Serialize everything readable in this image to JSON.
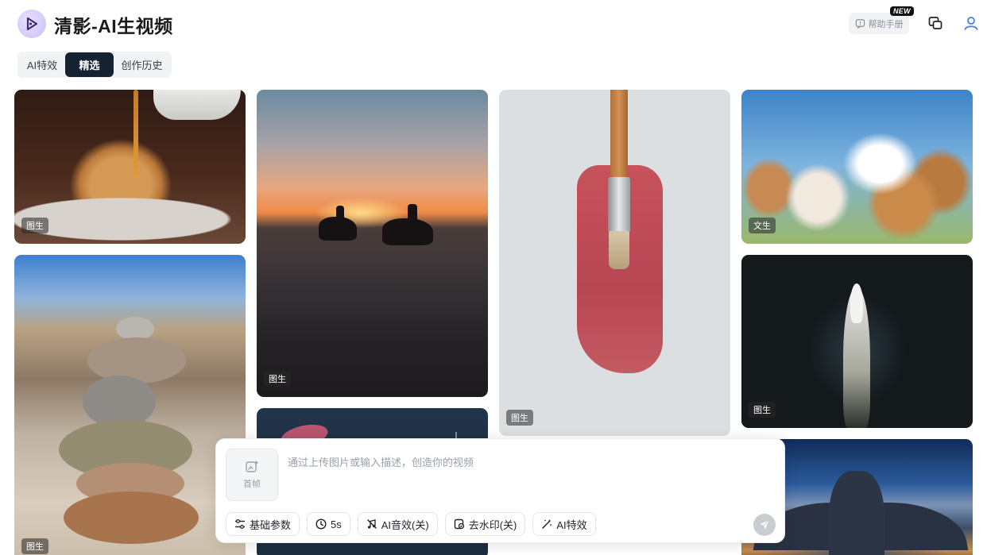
{
  "app": {
    "title": "清影-AI生视频",
    "logo_icon": "play-logo-icon",
    "accent": "#152232"
  },
  "header": {
    "help_label": "帮助手册",
    "new_badge": "NEW",
    "icons": [
      "help-manual-icon",
      "window-switch-icon",
      "user-icon"
    ]
  },
  "tabs": [
    {
      "label": "AI特效",
      "active": false
    },
    {
      "label": "精选",
      "active": true
    },
    {
      "label": "创作历史",
      "active": false
    }
  ],
  "gallery": [
    {
      "subject": "pancakes",
      "tag": "图生"
    },
    {
      "subject": "horse-riders-sunset",
      "tag": "图生"
    },
    {
      "subject": "paint-brush",
      "tag": "图生"
    },
    {
      "subject": "puppies",
      "tag": "文生"
    },
    {
      "subject": "stone-stack",
      "tag": "图生"
    },
    {
      "subject": "boat-aerial",
      "tag": "图生"
    },
    {
      "subject": "bird",
      "tag": ""
    },
    {
      "subject": "dragon-city",
      "tag": ""
    }
  ],
  "composer": {
    "upload_label": "首帧",
    "placeholder": "通过上传图片或输入描述，创造你的视频",
    "value": "",
    "tools": [
      {
        "icon": "sliders-icon",
        "label": "基础参数"
      },
      {
        "icon": "clock-icon",
        "label": "5s"
      },
      {
        "icon": "music-off-icon",
        "label": "AI音效(关)"
      },
      {
        "icon": "watermark-icon",
        "label": "去水印(关)"
      },
      {
        "icon": "magic-wand-icon",
        "label": "AI特效"
      }
    ],
    "send_icon": "send-icon"
  }
}
